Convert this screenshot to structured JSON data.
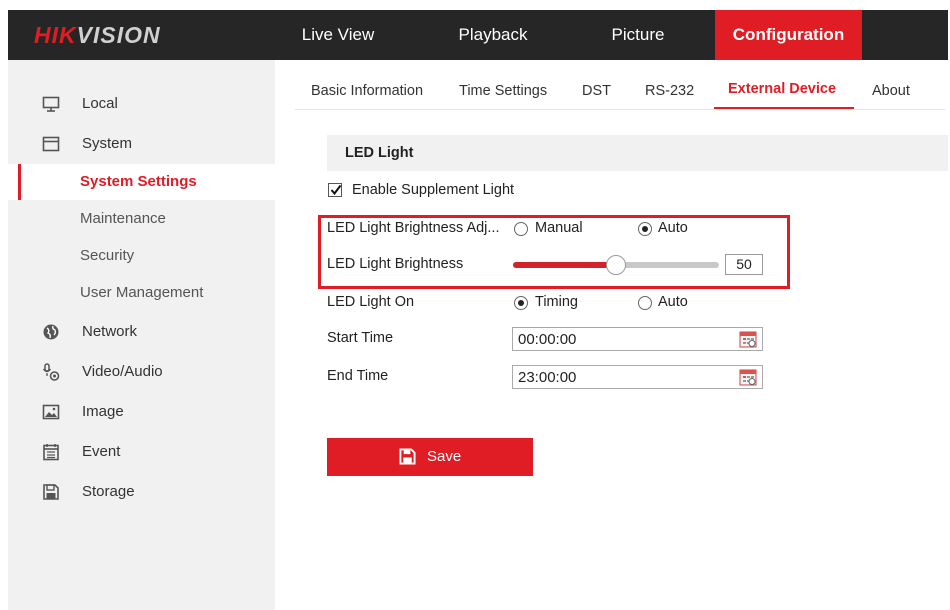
{
  "logo": {
    "brand_hik": "HIK",
    "brand_vision": "VISION"
  },
  "nav": {
    "live_view": "Live View",
    "playback": "Playback",
    "picture": "Picture",
    "configuration": "Configuration"
  },
  "sidebar": {
    "items": [
      {
        "label": "Local",
        "icon": "monitor-icon"
      },
      {
        "label": "System",
        "icon": "window-icon"
      },
      {
        "label": "System Settings"
      },
      {
        "label": "Maintenance"
      },
      {
        "label": "Security"
      },
      {
        "label": "User Management"
      },
      {
        "label": "Network",
        "icon": "globe-icon"
      },
      {
        "label": "Video/Audio",
        "icon": "mic-camera-icon"
      },
      {
        "label": "Image",
        "icon": "image-icon"
      },
      {
        "label": "Event",
        "icon": "calendar-list-icon"
      },
      {
        "label": "Storage",
        "icon": "floppy-icon"
      }
    ]
  },
  "tabs": [
    {
      "label": "Basic Information"
    },
    {
      "label": "Time Settings"
    },
    {
      "label": "DST"
    },
    {
      "label": "RS-232"
    },
    {
      "label": "External Device"
    },
    {
      "label": "About"
    }
  ],
  "section": {
    "title": "LED Light"
  },
  "form": {
    "enable_label": "Enable Supplement Light",
    "enable_checked": true,
    "brightness_adj_label": "LED Light Brightness Adj...",
    "adj_manual": "Manual",
    "adj_auto": "Auto",
    "adj_selected": "Auto",
    "brightness_label": "LED Light Brightness",
    "brightness_value": "50",
    "brightness_fraction": 0.5,
    "light_on_label": "LED Light On",
    "on_timing": "Timing",
    "on_auto": "Auto",
    "on_selected": "Timing",
    "start_label": "Start Time",
    "start_value": "00:00:00",
    "end_label": "End Time",
    "end_value": "23:00:00"
  },
  "save_label": "Save",
  "colors": {
    "accent": "#e01c24",
    "topbar": "#262626",
    "sidebar": "#f1f1f1"
  }
}
